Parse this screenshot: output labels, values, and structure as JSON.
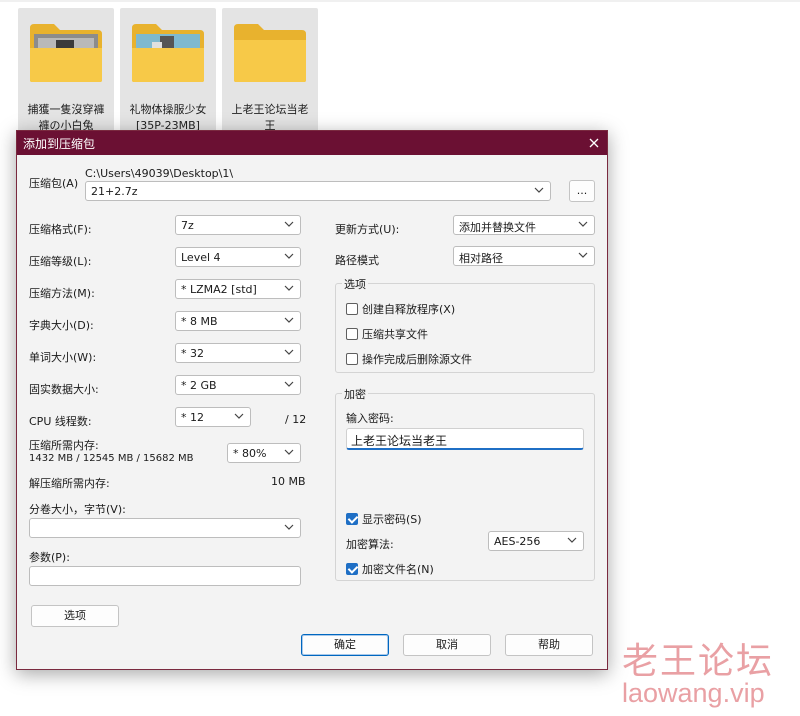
{
  "explorer": {
    "files": [
      {
        "name": "捕獲一隻沒穿褲\n褲の小白兔"
      },
      {
        "name": "礼物体操服少女\n[35P-23MB]"
      },
      {
        "name": "上老王论坛当老\n王"
      }
    ]
  },
  "dialog": {
    "title": "添加到压缩包",
    "close_icon": "close-icon",
    "archive": {
      "label": "压缩包(A)",
      "path": "C:\\Users\\49039\\Desktop\\1\\",
      "value": "21+2.7z",
      "browse_label": "..."
    },
    "left": {
      "format": {
        "label": "压缩格式(F):",
        "value": "7z"
      },
      "level": {
        "label": "压缩等级(L):",
        "value": "Level 4"
      },
      "method": {
        "label": "压缩方法(M):",
        "value": "* LZMA2 [std]"
      },
      "dict": {
        "label": "字典大小(D):",
        "value": "* 8 MB"
      },
      "word": {
        "label": "单词大小(W):",
        "value": "* 32"
      },
      "solid": {
        "label": "固实数据大小:",
        "value": "* 2 GB"
      },
      "threads": {
        "label": "CPU 线程数:",
        "value": "* 12",
        "max": "/ 12"
      },
      "memory": {
        "label": "压缩所需内存:",
        "detail": "1432 MB / 12545 MB / 15682 MB",
        "value": "* 80%"
      },
      "decompress": {
        "label": "解压缩所需内存:",
        "value": "10 MB"
      },
      "volume": {
        "label": "分卷大小，字节(V):",
        "value": ""
      },
      "params": {
        "label": "参数(P):",
        "value": ""
      },
      "options_button": "选项"
    },
    "right": {
      "update": {
        "label": "更新方式(U):",
        "value": "添加并替换文件"
      },
      "pathmode": {
        "label": "路径模式",
        "value": "相对路径"
      },
      "options": {
        "title": "选项",
        "sfx": {
          "label": "创建自释放程序(X)",
          "checked": false
        },
        "shared": {
          "label": "压缩共享文件",
          "checked": false
        },
        "delete": {
          "label": "操作完成后删除源文件",
          "checked": false
        }
      },
      "encryption": {
        "title": "加密",
        "password_label": "输入密码:",
        "password_value": "上老王论坛当老王",
        "show_password": {
          "label": "显示密码(S)",
          "checked": true
        },
        "method_label": "加密算法:",
        "method_value": "AES-256",
        "encrypt_names": {
          "label": "加密文件名(N)",
          "checked": true
        }
      }
    },
    "buttons": {
      "ok": "确定",
      "cancel": "取消",
      "help": "帮助"
    }
  },
  "watermark": {
    "title": "老王论坛",
    "url": "laowang.vip"
  },
  "colors": {
    "titlebar": "#6b1033",
    "accent": "#1f6fc5",
    "folder": "#f5c440"
  }
}
